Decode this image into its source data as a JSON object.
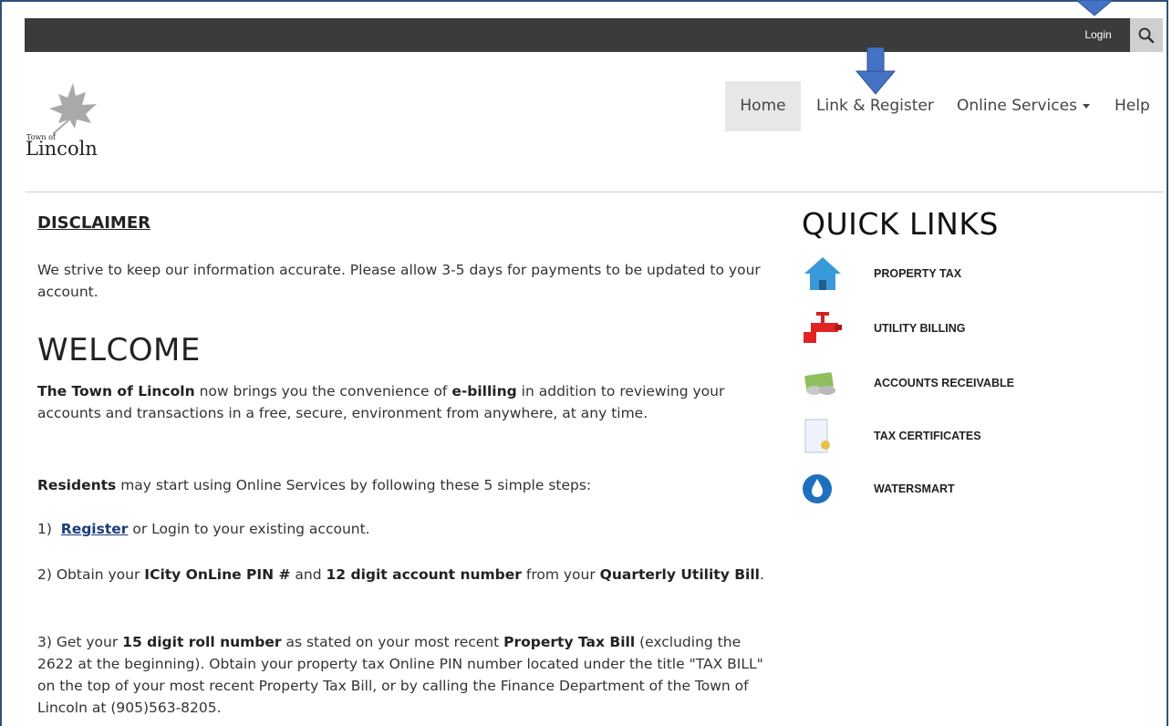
{
  "topbar": {
    "login_label": "Login",
    "search_icon": "search-icon"
  },
  "logo": {
    "town": "Town of",
    "name": "Lincoln"
  },
  "nav": {
    "home": "Home",
    "link_register": "Link & Register",
    "online_services": "Online Services",
    "help": "Help"
  },
  "main": {
    "disclaimer_title": "DISCLAIMER",
    "disclaimer_text": "We strive to keep our information accurate.  Please allow 3-5 days for payments to be updated to your account.",
    "welcome_title": "WELCOME",
    "intro_bold1": "The Town of Lincoln",
    "intro_t1": " now brings you the convenience of ",
    "intro_bold2": "e-billing",
    "intro_t2": " in addition to reviewing your accounts and transactions in a free, secure, environment from anywhere, at any time.",
    "residents_bold": "Residents",
    "residents_text": " may start using Online Services by following these 5 simple steps:",
    "step1_prefix": "1)  ",
    "step1_link": "Register",
    "step1_text": " or Login to your existing account.",
    "step2_t1": "2) Obtain your ",
    "step2_b1": "ICity OnLine PIN #",
    "step2_t2": " and ",
    "step2_b2": "12 digit account number",
    "step2_t3": " from your ",
    "step2_b3": "Quarterly Utility Bill",
    "step2_t4": ".",
    "step3_t1": "3) Get your ",
    "step3_b1": "15 digit roll number",
    "step3_t2": " as stated on your most recent ",
    "step3_b2": "Property Tax Bill",
    "step3_t3": " (excluding the 2622 at the beginning).  Obtain your property tax Online PIN number located under the title \"TAX BILL\" on the top of your most recent Property Tax Bill, or by calling the Finance Department of the Town of Lincoln at (905)563-8205."
  },
  "quick_links": {
    "title": "QUICK LINKS",
    "items": [
      {
        "label": "PROPERTY TAX",
        "icon": "house-icon"
      },
      {
        "label": "UTILITY BILLING",
        "icon": "water-tap-icon"
      },
      {
        "label": "ACCOUNTS RECEIVABLE",
        "icon": "money-icon"
      },
      {
        "label": "TAX CERTIFICATES",
        "icon": "certificate-icon"
      },
      {
        "label": "WATERSMART",
        "icon": "water-drop-icon"
      }
    ]
  },
  "colors": {
    "topbar": "#3b3b3b",
    "arrow": "#4472c4",
    "link": "#1a3d7c"
  }
}
